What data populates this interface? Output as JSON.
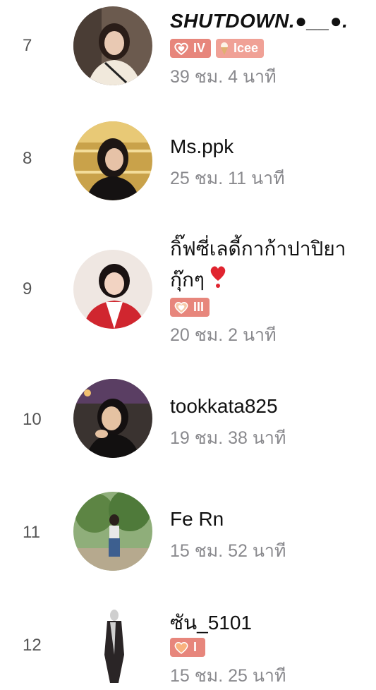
{
  "entries": [
    {
      "rank": "7",
      "name": "SHUTDOWN.●__●.",
      "badges": [
        {
          "label": "IV",
          "icon": "double-heart-icon"
        },
        {
          "label": "Icee",
          "icon": "ice-cream-icon"
        }
      ],
      "time": "39 ชม. 4 นาที"
    },
    {
      "rank": "8",
      "name": "Ms.ppk",
      "badges": [],
      "time": "25 ชม. 11 นาที"
    },
    {
      "rank": "9",
      "name": "กิ๊ฟซี่เลดี้กาก้าปาปิยา กุ๊กๆ",
      "name_emoji": "red-heart-emoji",
      "badges": [
        {
          "label": "III",
          "icon": "double-heart-icon"
        }
      ],
      "time": "20 ชม. 2 นาที"
    },
    {
      "rank": "10",
      "name": "tookkata825",
      "badges": [],
      "time": "19 ชม. 38 นาที"
    },
    {
      "rank": "11",
      "name": "Fe Rn",
      "badges": [],
      "time": "15 ชม. 52 นาที"
    },
    {
      "rank": "12",
      "name": "ซัน_5101",
      "badges": [
        {
          "label": "I",
          "icon": "heart-icon"
        }
      ],
      "time": "15 ชม. 25 นาที"
    }
  ],
  "colors": {
    "badge": "#e7867c",
    "badge_light": "#f0a196",
    "time_text": "#8a8a8e",
    "rank_text": "#555555"
  }
}
